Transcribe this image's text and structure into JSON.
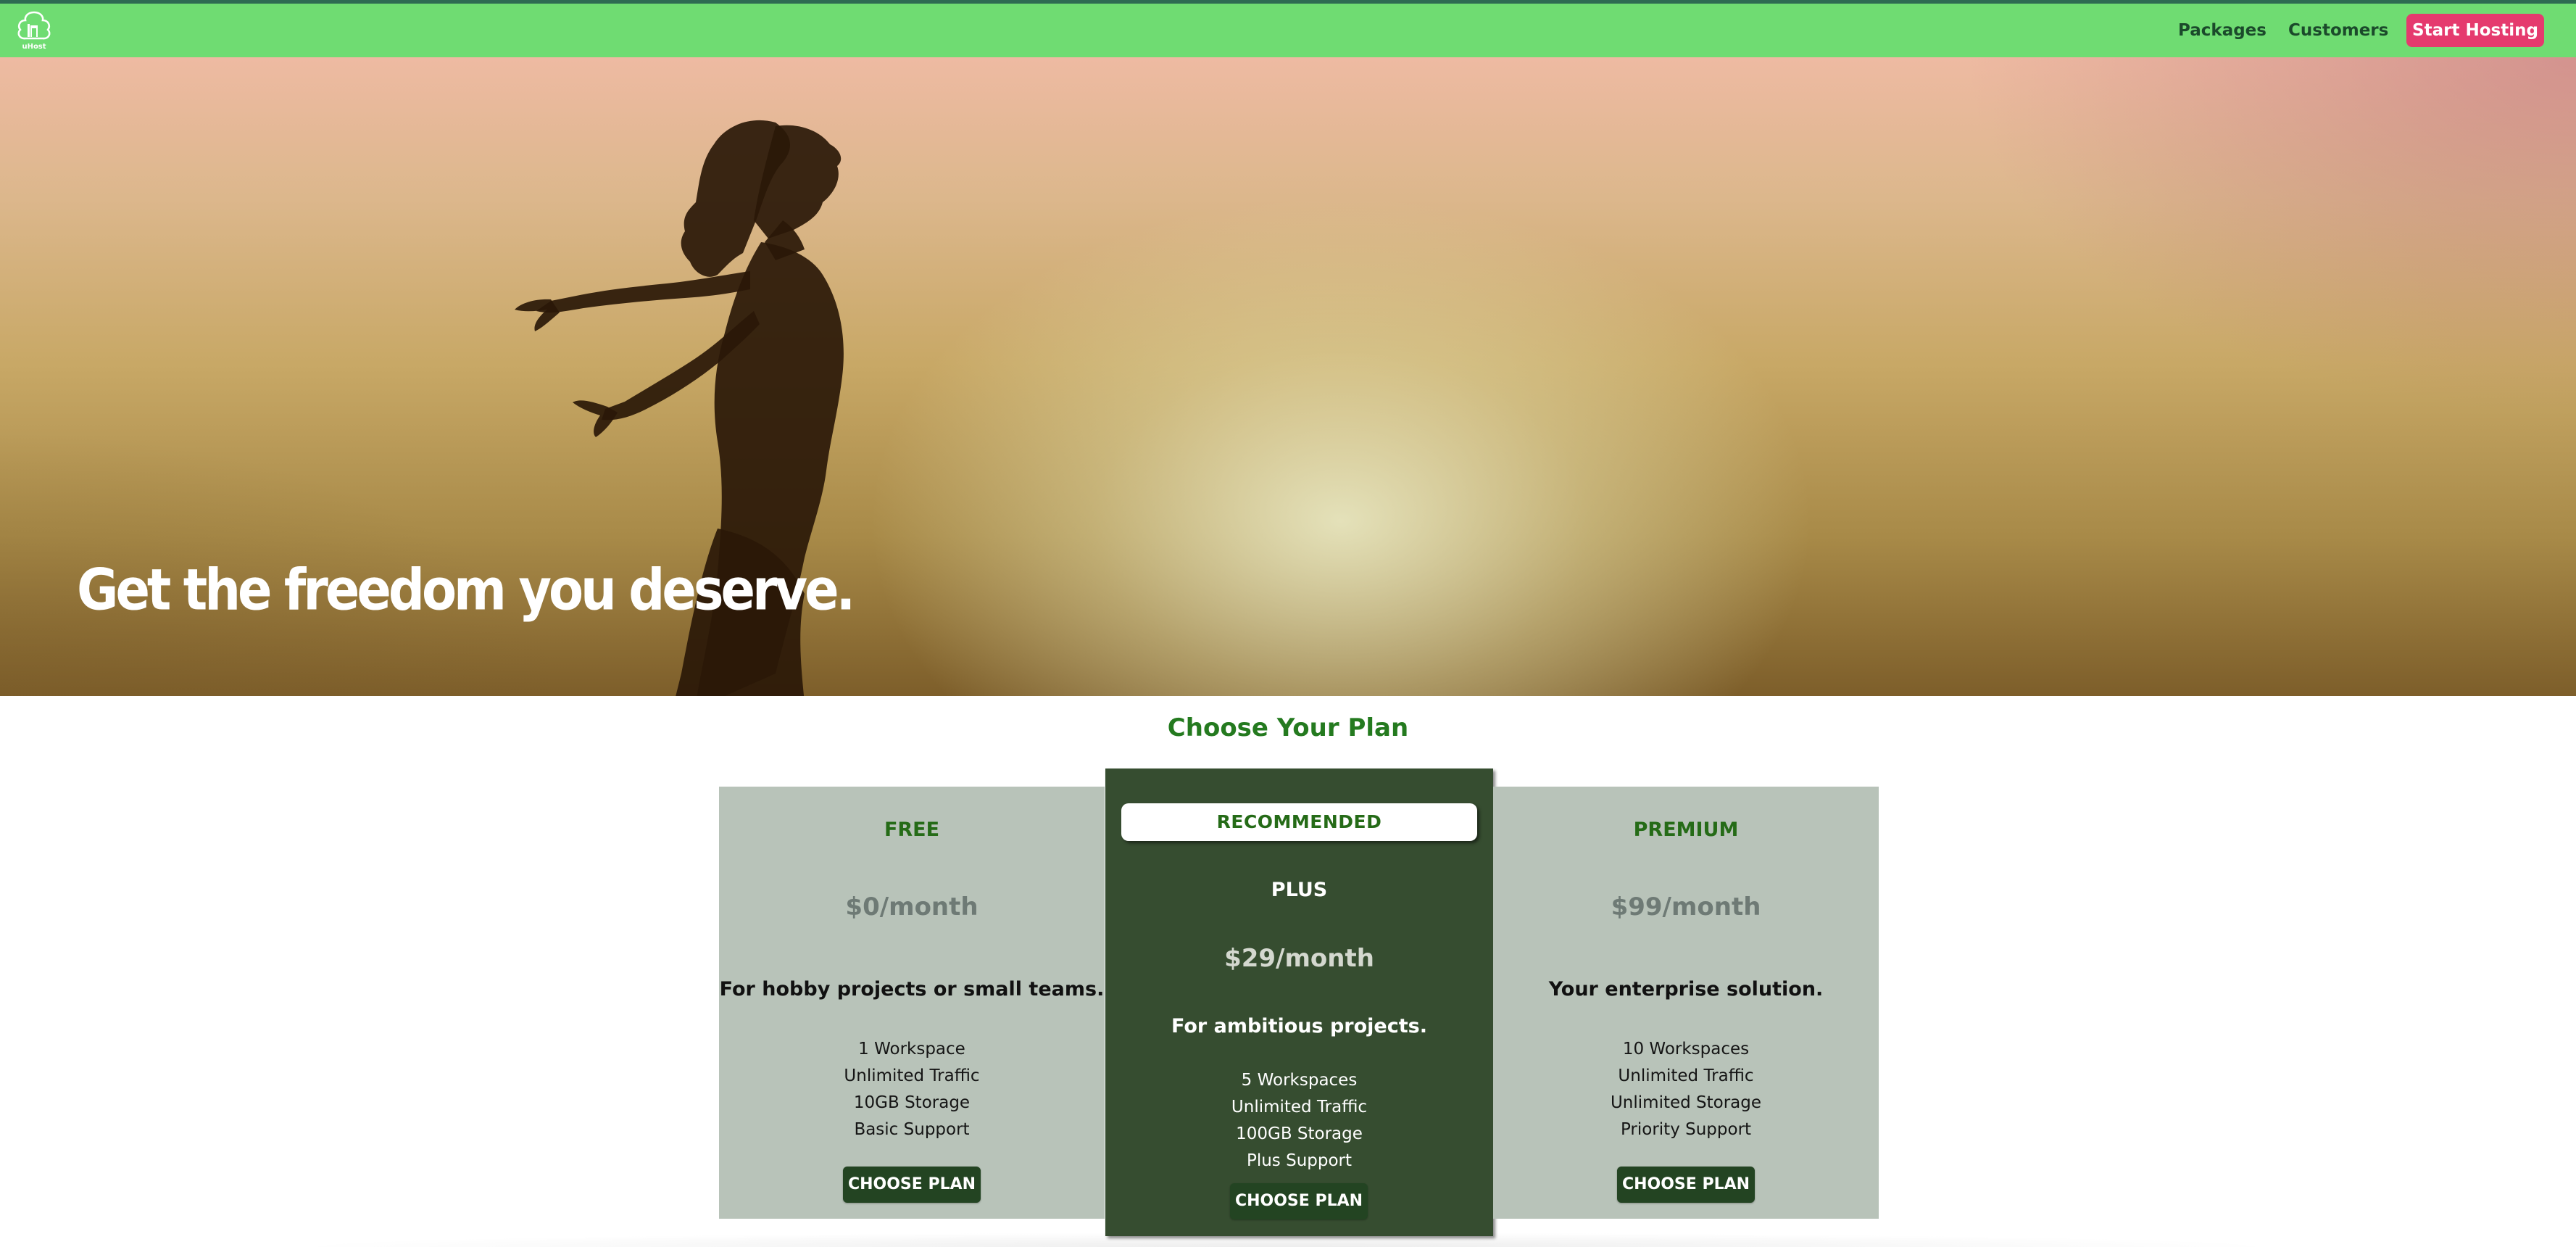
{
  "nav": {
    "logo_icon": "tree-house-logo-icon",
    "links": [
      {
        "label": "Packages"
      },
      {
        "label": "Customers"
      }
    ],
    "cta_label": "Start Hosting"
  },
  "hero": {
    "headline": "Get the freedom you deserve."
  },
  "plans_section": {
    "title": "Choose Your Plan",
    "plans": [
      {
        "name": "FREE",
        "price": "$0/month",
        "tagline": "For hobby projects or small teams.",
        "features": [
          "1 Workspace",
          "Unlimited Traffic",
          "10GB Storage",
          "Basic Support"
        ],
        "button_label": "CHOOSE PLAN"
      },
      {
        "badge": "RECOMMENDED",
        "name": "PLUS",
        "price": "$29/month",
        "tagline": "For ambitious projects.",
        "features": [
          "5 Workspaces",
          "Unlimited Traffic",
          "100GB Storage",
          "Plus Support"
        ],
        "button_label": "CHOOSE PLAN"
      },
      {
        "name": "PREMIUM",
        "price": "$99/month",
        "tagline": "Your enterprise solution.",
        "features": [
          "10 Workspaces",
          "Unlimited Traffic",
          "Unlimited Storage",
          "Priority Support"
        ],
        "button_label": "CHOOSE PLAN"
      }
    ]
  },
  "colors": {
    "nav_bg": "#6fdc72",
    "cta_bg": "#e53a6e",
    "accent_green": "#247a1f",
    "card_bg": "#b8c3b9",
    "featured_bg": "#364d30",
    "button_bg": "#234422"
  }
}
